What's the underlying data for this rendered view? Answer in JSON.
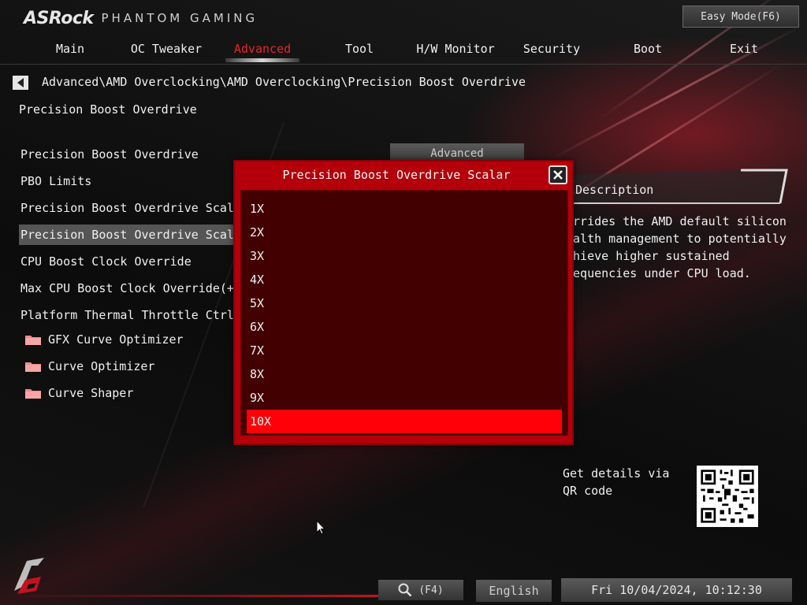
{
  "brand": {
    "logo": "ASRock",
    "subtitle": "PHANTOM GAMING"
  },
  "header": {
    "easy_mode": "Easy Mode(F6)"
  },
  "nav": {
    "tabs": [
      {
        "label": "Main"
      },
      {
        "label": "OC Tweaker"
      },
      {
        "label": "Advanced",
        "active": true
      },
      {
        "label": "Tool"
      },
      {
        "label": "H/W Monitor"
      },
      {
        "label": "Security"
      },
      {
        "label": "Boot"
      },
      {
        "label": "Exit"
      }
    ]
  },
  "breadcrumb": "Advanced\\AMD Overclocking\\AMD Overclocking\\Precision Boost Overdrive",
  "page_title": "Precision Boost Overdrive",
  "settings": {
    "items": [
      {
        "label": "Precision Boost Overdrive",
        "value": "Advanced"
      },
      {
        "label": "PBO Limits"
      },
      {
        "label": "Precision Boost Overdrive Scalar Ct"
      },
      {
        "label": "Precision Boost Overdrive Scalar",
        "selected": true
      },
      {
        "label": "CPU Boost Clock Override"
      },
      {
        "label": "Max CPU Boost Clock Override(+)"
      },
      {
        "label": "Platform Thermal Throttle Ctrl"
      }
    ],
    "folders": [
      {
        "label": "GFX Curve Optimizer"
      },
      {
        "label": "Curve Optimizer"
      },
      {
        "label": "Curve Shaper"
      }
    ]
  },
  "description": {
    "title": "Description",
    "text": "errides the AMD default silicon ealth management to potentially chieve higher sustained requencies under CPU load."
  },
  "qr": {
    "label": "Get details via QR code"
  },
  "dialog": {
    "title": "Precision Boost Overdrive Scalar",
    "options": [
      "1X",
      "2X",
      "3X",
      "4X",
      "5X",
      "6X",
      "7X",
      "8X",
      "9X",
      "10X"
    ],
    "selected_index": 9
  },
  "footer": {
    "search_key": "(F4)",
    "language": "English",
    "datetime": "Fri 10/04/2024, 10:12:30"
  },
  "colors": {
    "accent": "#e8242e",
    "dialog_bg": "#b3000a",
    "dialog_list_bg": "#430000",
    "selected_option": "#ff0008"
  }
}
